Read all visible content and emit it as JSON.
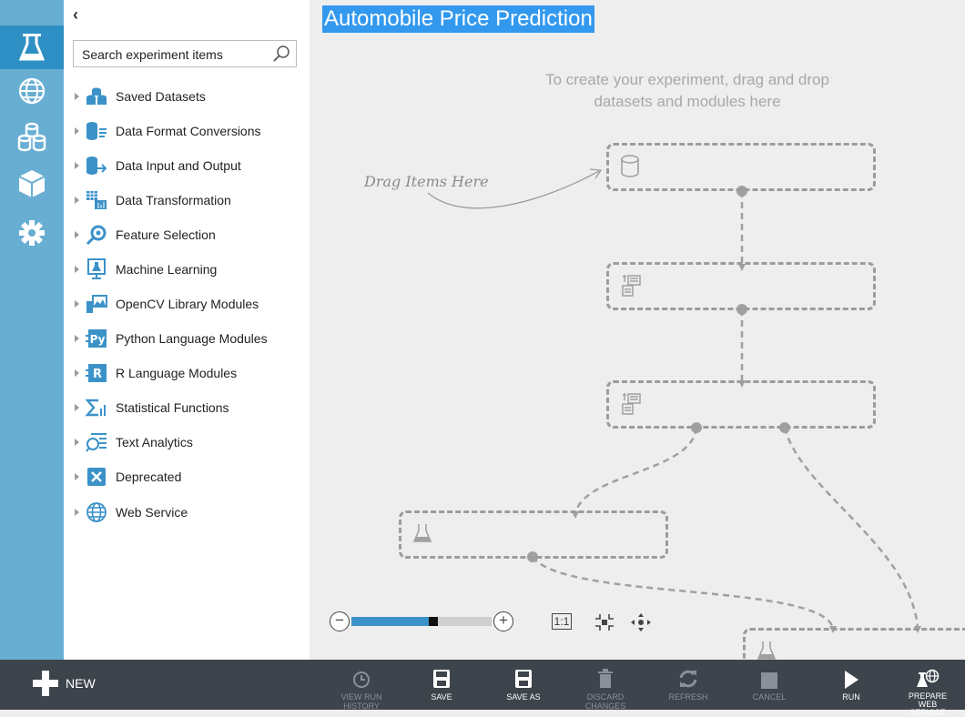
{
  "experiment": {
    "title": "Automobile Price Prediction"
  },
  "left_nav": {
    "items": [
      {
        "icon": "flask-icon",
        "active": true
      },
      {
        "icon": "globe-icon",
        "active": false
      },
      {
        "icon": "datasets-icon",
        "active": false
      },
      {
        "icon": "cube-icon",
        "active": false
      },
      {
        "icon": "gear-icon",
        "active": false
      }
    ]
  },
  "palette": {
    "collapse_label": "‹",
    "search": {
      "placeholder": "Search experiment items",
      "value": ""
    },
    "items": [
      {
        "label": "Saved Datasets",
        "icon": "saved-datasets-icon"
      },
      {
        "label": "Data Format Conversions",
        "icon": "data-format-conversions-icon"
      },
      {
        "label": "Data Input and Output",
        "icon": "data-input-output-icon"
      },
      {
        "label": "Data Transformation",
        "icon": "data-transformation-icon"
      },
      {
        "label": "Feature Selection",
        "icon": "feature-selection-icon"
      },
      {
        "label": "Machine Learning",
        "icon": "machine-learning-icon"
      },
      {
        "label": "OpenCV Library Modules",
        "icon": "opencv-icon"
      },
      {
        "label": "Python Language Modules",
        "icon": "python-icon"
      },
      {
        "label": "R Language Modules",
        "icon": "r-language-icon"
      },
      {
        "label": "Statistical Functions",
        "icon": "statistical-functions-icon"
      },
      {
        "label": "Text Analytics",
        "icon": "text-analytics-icon"
      },
      {
        "label": "Deprecated",
        "icon": "deprecated-icon"
      },
      {
        "label": "Web Service",
        "icon": "web-service-icon"
      }
    ]
  },
  "canvas": {
    "hint_line1": "To create your experiment, drag and drop",
    "hint_line2": "datasets and modules here",
    "drag_label": "Drag Items Here"
  },
  "zoom": {
    "out_label": "−",
    "in_label": "+",
    "actual_size_label": "1:1",
    "level": 0.55
  },
  "toolbar": {
    "new_label": "NEW",
    "buttons": [
      {
        "label": "VIEW RUN HISTORY",
        "icon": "history-icon",
        "enabled": false
      },
      {
        "label": "SAVE",
        "icon": "save-icon",
        "enabled": true
      },
      {
        "label": "SAVE AS",
        "icon": "save-as-icon",
        "enabled": true
      },
      {
        "label": "DISCARD CHANGES",
        "icon": "trash-icon",
        "enabled": false
      },
      {
        "label": "REFRESH",
        "icon": "refresh-icon",
        "enabled": false
      },
      {
        "label": "CANCEL",
        "icon": "stop-icon",
        "enabled": false
      },
      {
        "label": "RUN",
        "icon": "play-icon",
        "enabled": true
      },
      {
        "label": "PREPARE WEB SERVICE",
        "icon": "prepare-web-service-icon",
        "enabled": true
      }
    ]
  },
  "colors": {
    "nav_bg": "#68aed3",
    "nav_active": "#2d8fc3",
    "toolbar_bg": "#3d444c",
    "accent": "#3b92c8",
    "title_highlight": "#3399ee"
  }
}
